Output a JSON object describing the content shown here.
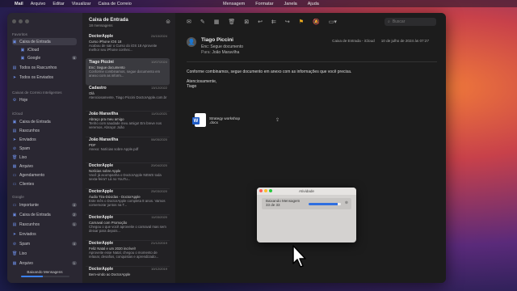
{
  "menubar": {
    "apple": "",
    "app": "Mail",
    "menus": [
      "Arquivo",
      "Editar",
      "Visualizar",
      "Caixa de Correio"
    ],
    "menus_right": [
      "Mensagem",
      "Formatar",
      "Janela",
      "Ajuda"
    ]
  },
  "sidebar": {
    "favorites_title": "Favoritos",
    "favorites": [
      {
        "label": "Caixa de Entrada",
        "icon": "inbox-icon",
        "count": ""
      },
      {
        "label": "iCloud",
        "icon": "inbox-icon",
        "count": ""
      },
      {
        "label": "Google",
        "icon": "inbox-icon",
        "count": "6"
      },
      {
        "label": "Todos os Rascunhos",
        "icon": "draft-icon",
        "count": ""
      },
      {
        "label": "Todos os Enviados",
        "icon": "sent-icon",
        "count": ""
      }
    ],
    "smart_title": "Caixas de Correio Inteligentes",
    "smart": [
      {
        "label": "Hoje",
        "icon": "gear-icon"
      }
    ],
    "icloud_title": "iCloud",
    "icloud": [
      {
        "label": "Caixa de Entrada",
        "icon": "inbox-icon"
      },
      {
        "label": "Rascunhos",
        "icon": "draft-icon"
      },
      {
        "label": "Enviados",
        "icon": "sent-icon"
      },
      {
        "label": "Spam",
        "icon": "spam-icon"
      },
      {
        "label": "Lixo",
        "icon": "trash-icon"
      },
      {
        "label": "Arquivo",
        "icon": "archive-icon"
      },
      {
        "label": "Agendamento",
        "icon": "folder-icon"
      },
      {
        "label": "Clientes",
        "icon": "folder-icon"
      }
    ],
    "google_title": "Google",
    "google": [
      {
        "label": "Importante",
        "icon": "folder-icon",
        "count": "4"
      },
      {
        "label": "Caixa de Entrada",
        "icon": "inbox-icon",
        "count": "2"
      },
      {
        "label": "Rascunhos",
        "icon": "draft-icon",
        "count": "1"
      },
      {
        "label": "Enviados",
        "icon": "sent-icon",
        "count": ""
      },
      {
        "label": "Spam",
        "icon": "spam-icon",
        "count": "4"
      },
      {
        "label": "Lixo",
        "icon": "trash-icon",
        "count": ""
      },
      {
        "label": "Arquivo",
        "icon": "archive-icon",
        "count": "1"
      }
    ],
    "footer_label": "Baixando Mensagens",
    "footer_progress": 0.45
  },
  "list": {
    "title": "Caixa de Entrada",
    "subtitle": "18 mensagens",
    "messages": [
      {
        "from": "DoctorApple",
        "date": "24/10/2024",
        "subject": "Curso iPhone iOS 18",
        "preview": "Acabou de sair o Curso do iOS 18 Aproveite melhor seu iPhone conhec..."
      },
      {
        "from": "Tiago Piccini",
        "tag": "Caixa ...",
        "date": "10/07/2024",
        "subject": "Enc: Segue documento",
        "preview": "Conforme combinamos, segue documento em anexo com as inform..."
      },
      {
        "from": "Cadastro",
        "date": "13/12/2022",
        "subject": "Olá",
        "preview": "Atenciosamente, Tiago Piccini DoctorApple.com.br"
      },
      {
        "from": "João Maravilha",
        "date": "11/01/2021",
        "subject": "Abraço pra meu amigo",
        "preview": "Tenho com saudade meu amigo! Em breve nos veremos. Abraço! João"
      },
      {
        "from": "João Maravilha",
        "date": "06/05/2020",
        "subject": "PDF",
        "preview": "Anexo: Notícias sobre Apple.pdf"
      },
      {
        "from": "DoctorApple",
        "date": "20/04/2020",
        "subject": "Notícias sobre Apple",
        "preview": "Você já acompanha o DoctorApple NEWS toda sexta-feira? Lá no YouTu..."
      },
      {
        "from": "DoctorApple",
        "date": "25/03/2020",
        "subject": "Áudio Tira-Dúvidas - DoctorApple",
        "preview": "Este mês o DoctorApple completa 8 anos. Vamos comemorar juntos na T..."
      },
      {
        "from": "DoctorApple",
        "date": "11/03/2020",
        "subject": "Carnaval com Promoção",
        "preview": "Chegou o que você aproveite o carnaval mas sem deixar para depois..."
      },
      {
        "from": "DoctorApple",
        "date": "21/12/2019",
        "subject": "Feliz Natal e um 2020 incrível!",
        "preview": "Aproveite esse Natal, chegou o momento de relaxar, desafios, conquistas e aprendizado..."
      },
      {
        "from": "DoctorApple",
        "date": "10/12/2019",
        "subject": "Bem-vindo ao DoctorApple",
        "preview": ""
      }
    ]
  },
  "reader": {
    "search_placeholder": "Buscar",
    "sender": "Tiago Piccini",
    "subject_label": "Enc:",
    "subject": "Segue documento",
    "to_label": "Para:",
    "to": "João Maravilha",
    "mailbox": "Caixa de Entrada - iCloud",
    "date": "10 de julho de 2024 às 07:27",
    "body_line1": "Conforme combinamos, segue documento em anexo com as informações que você precisa.",
    "body_line2": "Atenciosamente,",
    "body_line3": "Tiago",
    "attachment_name": "Strategy workshop",
    "attachment_ext": ".docx"
  },
  "activity": {
    "title": "Atividade",
    "task": "Baixando Mensagem",
    "progress_text": "33 de 33",
    "progress": 0.9
  },
  "colors": {
    "accent": "#3b82f6",
    "flag": "#f2b01e"
  }
}
